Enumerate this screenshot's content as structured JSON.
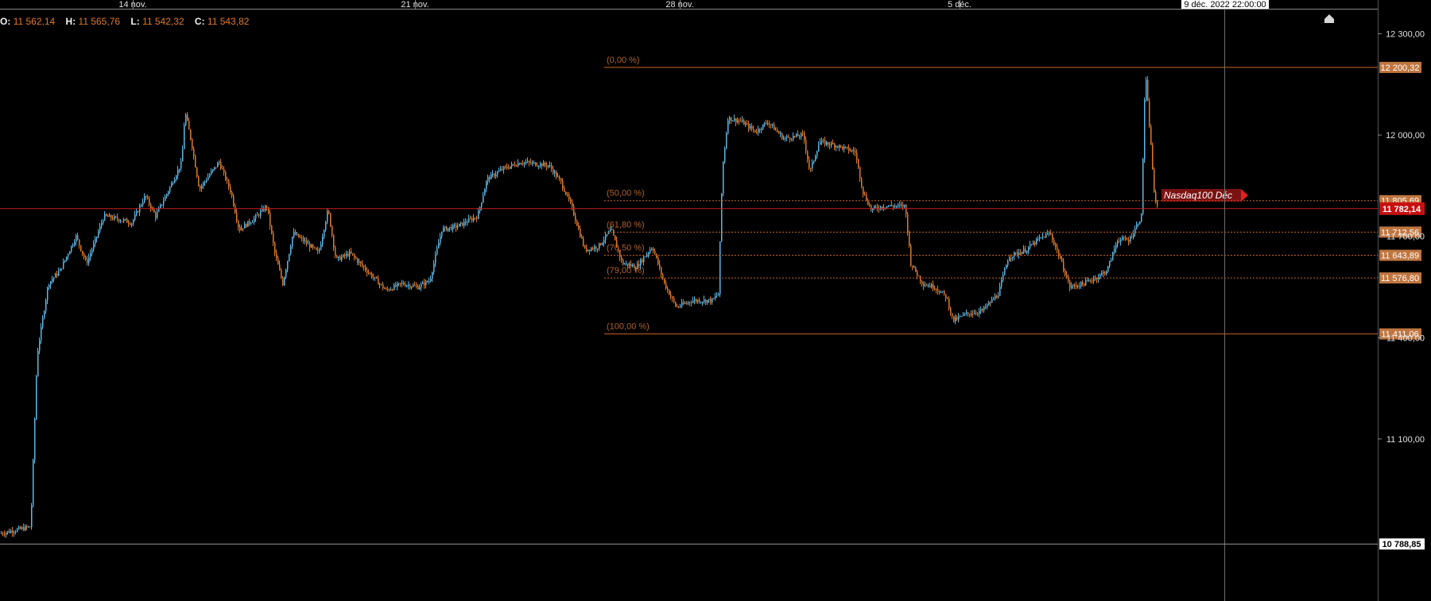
{
  "ohlc_header": {
    "o_label": "O:",
    "o_value": "11 562,14",
    "h_label": "H:",
    "h_value": "11 565,76",
    "l_label": "L:",
    "l_value": "11 542,32",
    "c_label": "C:",
    "c_value": "11 543,82"
  },
  "colors": {
    "background": "#000000",
    "candle_up": "#5bb8e6",
    "candle_down": "#e07a2a",
    "fib_line": "#c8641e",
    "fib_text": "#b0622a",
    "current_price_line": "#c81e1e",
    "current_price_badge": "#c81010",
    "label_badge": "#c07640",
    "axis_text": "#e0e0e0",
    "crosshair": "#6b6b6b",
    "annotation_arrow": "#e02020"
  },
  "chart_data": {
    "type": "candlestick",
    "instrument_label": "Nasdaq100 Déc",
    "x_tick_labels": [
      "14 nov.",
      "21 nov.",
      "28 nov.",
      "5 déc."
    ],
    "crosshair_time_label": "9 déc. 2022 22:00:00",
    "y_tick_labels": [
      "12 300,00",
      "12 000,00",
      "11 700,00",
      "11 400,00",
      "11 100,00"
    ],
    "y_ticks": [
      12300,
      12000,
      11700,
      11400,
      11100
    ],
    "ylim": [
      10620,
      12400
    ],
    "current_price": 11782.14,
    "current_price_label": "11 782,14",
    "crosshair_price_label": "10 788,85",
    "crosshair_price": 10788.85,
    "fibonacci": {
      "high": 12200.32,
      "low": 11411.06,
      "levels": [
        {
          "label": "(0,00 %)",
          "value": 12200.32,
          "badge": "12 200,32",
          "style": "solid"
        },
        {
          "label": "(50,00 %)",
          "value": 11805.69,
          "badge": "11 805,69",
          "style": "dotted"
        },
        {
          "label": "(61,80 %)",
          "value": 11712.56,
          "badge": "11 712,56",
          "style": "dotted"
        },
        {
          "label": "(70,50 %)",
          "value": 11643.89,
          "badge": "11 643,89",
          "style": "dotted"
        },
        {
          "label": "(79,00 %)",
          "value": 11576.8,
          "badge": "11 576,80",
          "style": "dotted"
        },
        {
          "label": "(100,00 %)",
          "value": 11411.06,
          "badge": "11 411,06",
          "style": "solid"
        }
      ]
    },
    "price_path": [
      [
        0,
        10820
      ],
      [
        38,
        10840
      ],
      [
        46,
        11350
      ],
      [
        60,
        11560
      ],
      [
        75,
        11600
      ],
      [
        95,
        11700
      ],
      [
        108,
        11620
      ],
      [
        118,
        11680
      ],
      [
        130,
        11760
      ],
      [
        150,
        11750
      ],
      [
        165,
        11740
      ],
      [
        182,
        11820
      ],
      [
        195,
        11760
      ],
      [
        212,
        11840
      ],
      [
        228,
        11920
      ],
      [
        232,
        12070
      ],
      [
        240,
        11980
      ],
      [
        250,
        11840
      ],
      [
        262,
        11880
      ],
      [
        275,
        11920
      ],
      [
        290,
        11830
      ],
      [
        300,
        11720
      ],
      [
        318,
        11750
      ],
      [
        335,
        11790
      ],
      [
        345,
        11650
      ],
      [
        355,
        11560
      ],
      [
        368,
        11710
      ],
      [
        385,
        11680
      ],
      [
        400,
        11650
      ],
      [
        412,
        11780
      ],
      [
        422,
        11630
      ],
      [
        440,
        11650
      ],
      [
        460,
        11600
      ],
      [
        485,
        11540
      ],
      [
        505,
        11560
      ],
      [
        525,
        11550
      ],
      [
        540,
        11570
      ],
      [
        555,
        11720
      ],
      [
        575,
        11730
      ],
      [
        600,
        11760
      ],
      [
        612,
        11870
      ],
      [
        632,
        11900
      ],
      [
        655,
        11920
      ],
      [
        690,
        11910
      ],
      [
        705,
        11860
      ],
      [
        718,
        11790
      ],
      [
        735,
        11660
      ],
      [
        752,
        11670
      ],
      [
        768,
        11720
      ],
      [
        782,
        11620
      ],
      [
        800,
        11610
      ],
      [
        820,
        11670
      ],
      [
        835,
        11560
      ],
      [
        850,
        11490
      ],
      [
        870,
        11510
      ],
      [
        895,
        11510
      ],
      [
        903,
        11530
      ],
      [
        908,
        11900
      ],
      [
        915,
        12050
      ],
      [
        932,
        12040
      ],
      [
        950,
        12010
      ],
      [
        965,
        12040
      ],
      [
        985,
        11990
      ],
      [
        1010,
        12000
      ],
      [
        1018,
        11890
      ],
      [
        1030,
        11980
      ],
      [
        1050,
        11970
      ],
      [
        1075,
        11950
      ],
      [
        1085,
        11830
      ],
      [
        1095,
        11780
      ],
      [
        1112,
        11790
      ],
      [
        1138,
        11790
      ],
      [
        1145,
        11620
      ],
      [
        1160,
        11560
      ],
      [
        1175,
        11550
      ],
      [
        1190,
        11520
      ],
      [
        1198,
        11450
      ],
      [
        1215,
        11470
      ],
      [
        1235,
        11480
      ],
      [
        1255,
        11530
      ],
      [
        1268,
        11640
      ],
      [
        1290,
        11660
      ],
      [
        1305,
        11690
      ],
      [
        1320,
        11710
      ],
      [
        1332,
        11640
      ],
      [
        1345,
        11550
      ],
      [
        1362,
        11560
      ],
      [
        1380,
        11580
      ],
      [
        1392,
        11600
      ],
      [
        1405,
        11690
      ],
      [
        1420,
        11690
      ],
      [
        1435,
        11760
      ],
      [
        1440,
        12190
      ],
      [
        1446,
        12000
      ],
      [
        1452,
        11800
      ],
      [
        1456,
        11783
      ]
    ]
  }
}
